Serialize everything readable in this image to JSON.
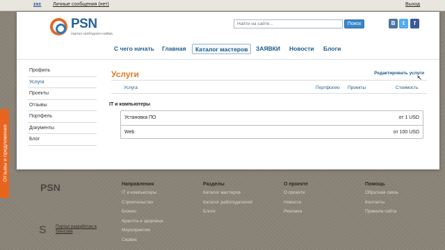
{
  "topbar": {
    "username": "zxc",
    "messages_link": "Личные сообщения (нет)",
    "logout_link": "Выход"
  },
  "header": {
    "logo_text": "PSN",
    "logo_tagline": "портал свободного найма",
    "search_placeholder": "Найти на сайте...",
    "search_button": "Поиск",
    "social": [
      "В",
      "t",
      "f"
    ]
  },
  "nav": {
    "items": [
      {
        "label": "С чего начать"
      },
      {
        "label": "Главная"
      },
      {
        "label": "Каталог мастеров"
      },
      {
        "label": "ЗАЯВКИ"
      },
      {
        "label": "Новости"
      },
      {
        "label": "Блоги"
      }
    ],
    "active": "Каталог мастеров"
  },
  "sidebar": {
    "items": [
      {
        "label": "Профиль"
      },
      {
        "label": "Услуги"
      },
      {
        "label": "Проекты"
      },
      {
        "label": "Отзывы"
      },
      {
        "label": "Портфель"
      },
      {
        "label": "Документы"
      },
      {
        "label": "Блог"
      }
    ],
    "active": "Услуги"
  },
  "content": {
    "title": "Услуги",
    "edit_link": "Редактировать услуги",
    "columns": {
      "service": "Услуга",
      "portfolio": "Портфолио",
      "projects": "Проекты",
      "cost": "Стоимость"
    },
    "category": "IT и компьютеры",
    "services": [
      {
        "name": "Установка ПО",
        "price": "от 1 USD"
      },
      {
        "name": "Web",
        "price": "от 100 USD"
      }
    ]
  },
  "feedback_tab": "Отзывы и предложения",
  "footer": {
    "logo": "PSN",
    "columns": [
      {
        "title": "Направления",
        "links": [
          "IT и компьютеры",
          "Строительство",
          "Бизнес",
          "Красота и здоровье",
          "Мероприятия",
          "Сервис"
        ]
      },
      {
        "title": "Разделы",
        "links": [
          "Каталог мастеров",
          "Каталог работодателей",
          "Блоги"
        ]
      },
      {
        "title": "О проекте",
        "links": [
          "О проекте",
          "Новости",
          "Реклама"
        ]
      },
      {
        "title": "Помощь",
        "links": [
          "Обратная связь",
          "Контакты",
          "Правила сайта"
        ]
      }
    ],
    "made_by": "Портал разработан в Siteicode"
  },
  "colors": {
    "accent_orange": "#e07a1f",
    "link_blue": "#1a5a8c",
    "background": "#8b8478"
  }
}
